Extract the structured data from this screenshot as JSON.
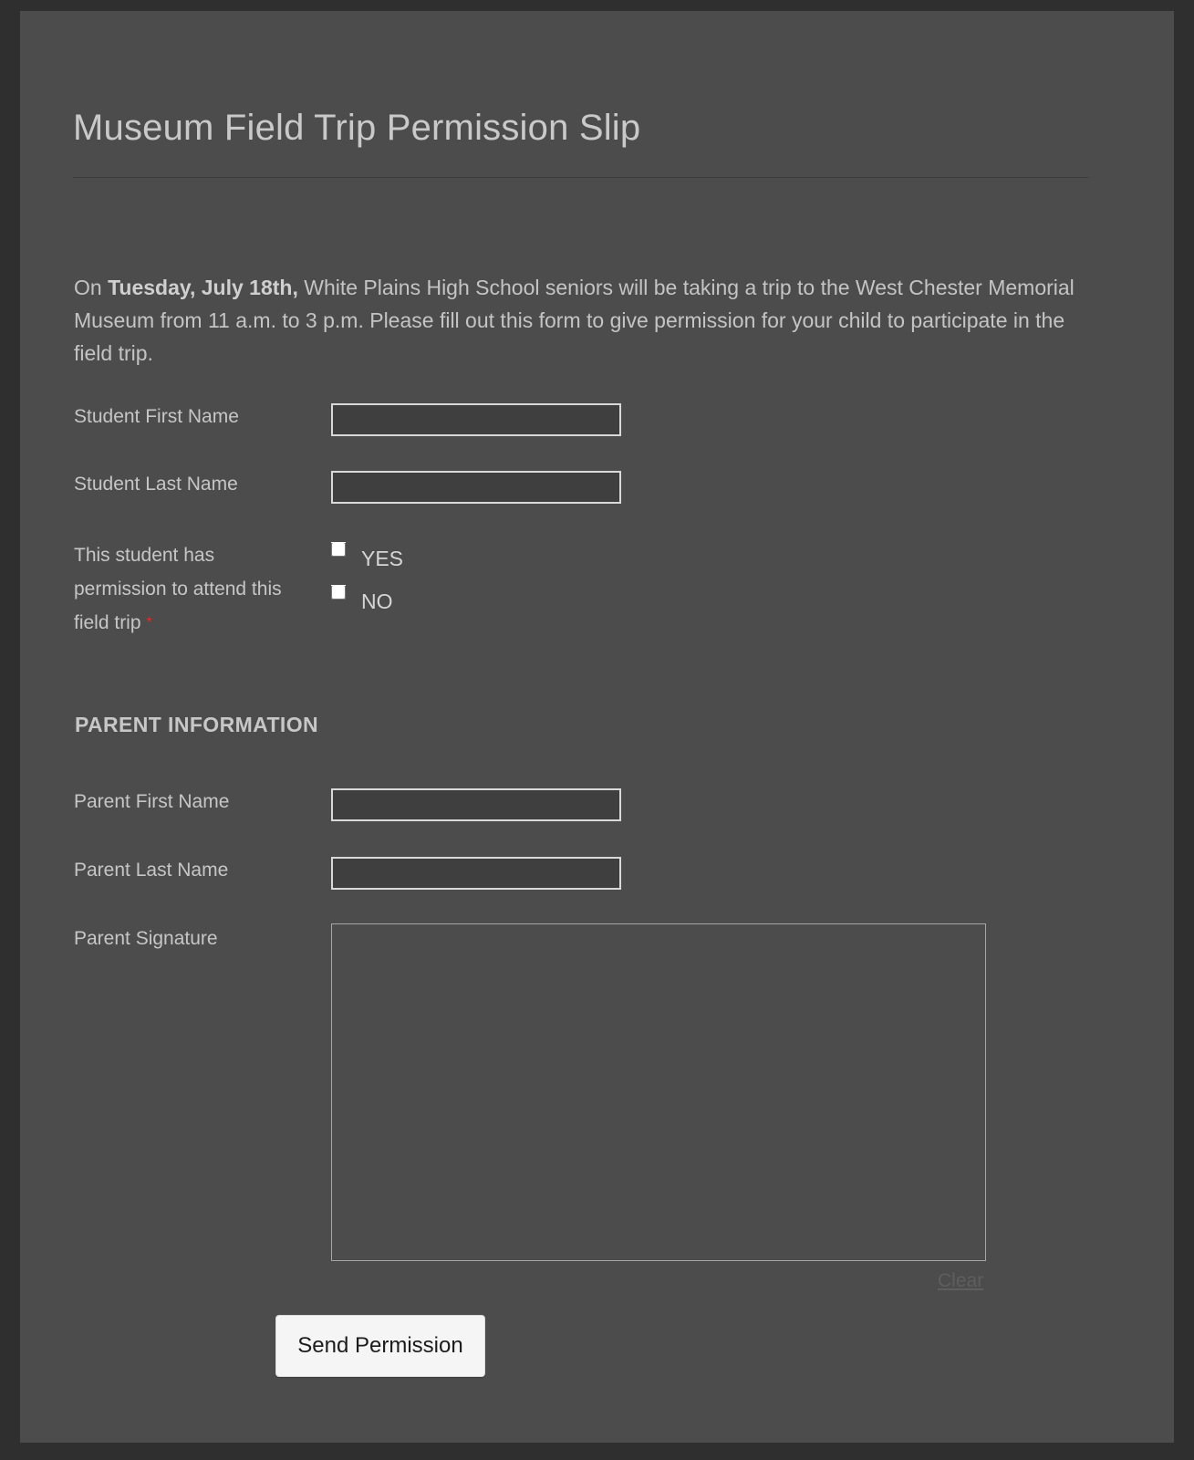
{
  "form": {
    "title": "Museum Field Trip Permission Slip",
    "intro": {
      "before_bold": "On ",
      "bold": "Tuesday, July 18th,",
      "after_bold": " White Plains High School seniors will be taking a trip to the West Chester Memorial Museum from 11 a.m. to 3 p.m. Please fill out this form to give permission for your child to participate in the field trip."
    },
    "fields": {
      "student_first_name": {
        "label": "Student First Name",
        "value": "",
        "placeholder": ""
      },
      "student_last_name": {
        "label": "Student Last Name",
        "value": "",
        "placeholder": ""
      },
      "permission": {
        "label": "This student has permission to attend this field trip",
        "required_marker": "*",
        "options": [
          {
            "label": "YES",
            "checked": false
          },
          {
            "label": "NO",
            "checked": false
          }
        ]
      },
      "parent_first_name": {
        "label": "Parent First Name",
        "value": "",
        "placeholder": ""
      },
      "parent_last_name": {
        "label": "Parent Last Name",
        "value": "",
        "placeholder": ""
      },
      "parent_signature": {
        "label": "Parent Signature",
        "clear_label": "Clear"
      }
    },
    "sections": {
      "parent_information": "PARENT INFORMATION"
    },
    "submit_label": "Send Permission",
    "colors": {
      "page_border": "#2f2f2f",
      "panel_background": "#4c4c4c",
      "text": "#c6c6c6",
      "input_fill": "#3f3f3f",
      "input_border": "#d9d9d9",
      "required_star": "#ff2020",
      "submit_background": "#f5f5f5",
      "submit_text": "#1c1c1c",
      "link": "#5e5e5e"
    }
  }
}
